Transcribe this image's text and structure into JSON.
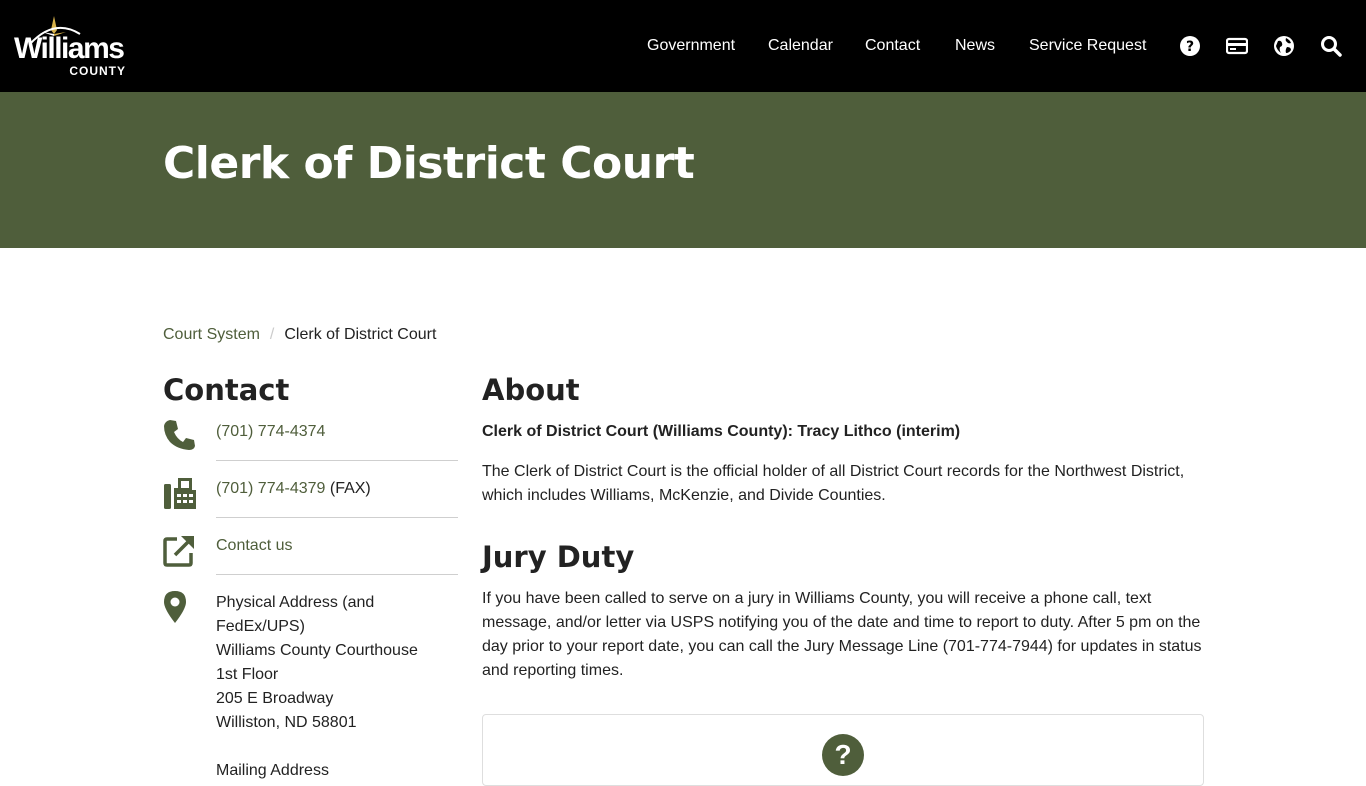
{
  "header": {
    "logo_word": "Williams",
    "logo_sub": "COUNTY",
    "nav": [
      "Government",
      "Calendar",
      "Contact",
      "News",
      "Service Request"
    ],
    "icons": [
      "help-icon",
      "payment-card-icon",
      "globe-icon",
      "search-icon"
    ]
  },
  "hero": {
    "title": "Clerk of District Court"
  },
  "breadcrumb": {
    "parent": "Court System",
    "separator": "/",
    "current": "Clerk of District Court"
  },
  "contact": {
    "title": "Contact",
    "phone": "(701) 774-4374",
    "fax_number": "(701) 774-4379",
    "fax_suffix": " (FAX)",
    "contact_link": "Contact us",
    "address_lines": [
      "Physical Address (and",
      "FedEx/UPS)",
      "Williams County Courthouse",
      "1st Floor",
      "205 E Broadway",
      "Williston, ND 58801",
      "",
      "Mailing Address"
    ]
  },
  "about": {
    "title": "About",
    "lead": "Clerk of District Court (Williams County): Tracy Lithco (interim)",
    "body": "The Clerk of District Court is the official holder of all District Court records for the Northwest District, which includes Williams, McKenzie, and Divide Counties."
  },
  "jury": {
    "title": "Jury Duty",
    "body": "If you have been called to serve on a jury in Williams County, you will receive a phone call, text message, and/or letter via USPS notifying you of the date and time to report to duty. After 5 pm on the day prior to your report date, you can call the Jury Message Line (701-774-7944) for updates in status and reporting times."
  },
  "faq_card": {
    "icon": "question-icon",
    "glyph": "?"
  },
  "colors": {
    "header_bg": "#000000",
    "hero_bg": "#4f5e3b",
    "accent": "#4f5e3b",
    "logo_star": "#d6b14a"
  }
}
